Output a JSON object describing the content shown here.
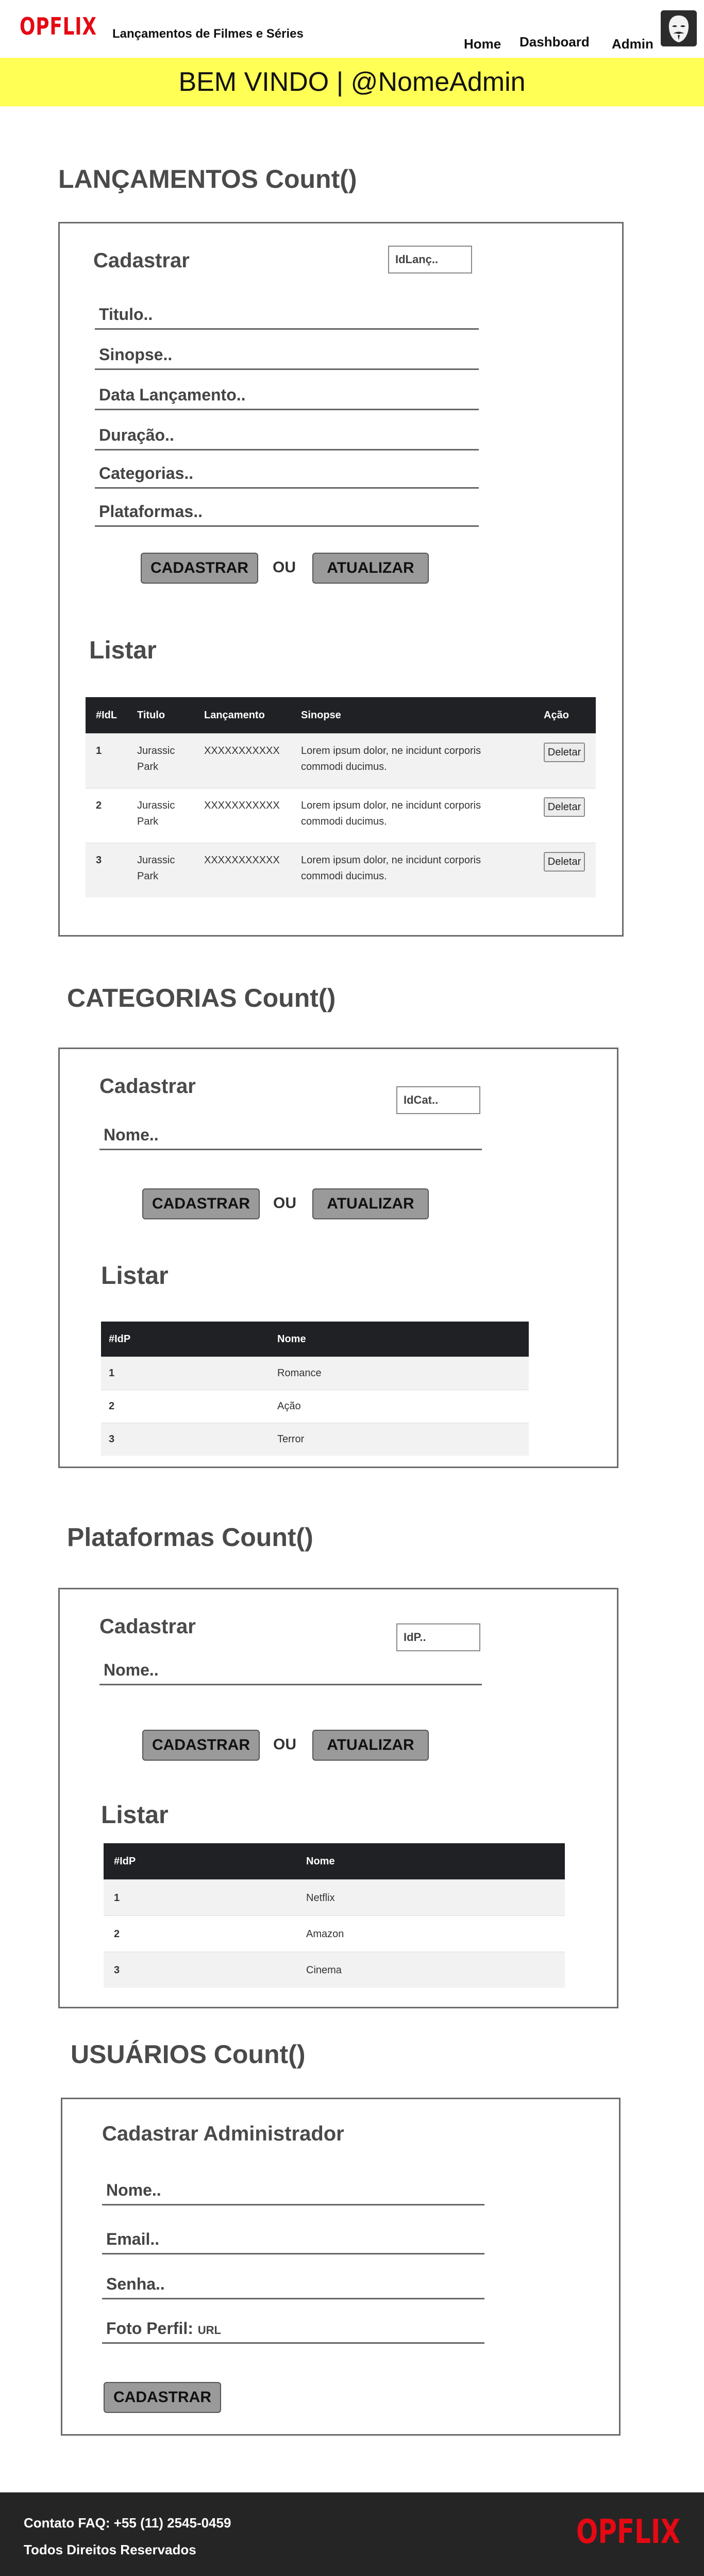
{
  "header": {
    "logo": "OPFLIX",
    "site_title": "Lançamentos de Filmes e Séries",
    "nav": {
      "home": "Home",
      "dashboard": "Dashboard",
      "admin": "Admin"
    }
  },
  "banner": {
    "text": "BEM VINDO | @NomeAdmin"
  },
  "lancamentos": {
    "title": "LANÇAMENTOS Count()",
    "form_title": "Cadastrar",
    "id_placeholder": "IdLanç..",
    "fields": [
      "Titulo..",
      "Sinopse..",
      "Data Lançamento..",
      "Duração..",
      "Categorias..",
      "Plataformas.."
    ],
    "btn_cadastrar": "CADASTRAR",
    "ou": "OU",
    "btn_atualizar": "ATUALIZAR",
    "list_title": "Listar",
    "columns": [
      "#IdL",
      "Titulo",
      "Lançamento",
      "Sinopse",
      "Ação"
    ],
    "rows": [
      {
        "id": "1",
        "titulo_1": "Jurassic",
        "titulo_2": "Park",
        "lancamento": "XXXXXXXXXXX",
        "sinopse_1": "Lorem ipsum dolor, ne incidunt corporis",
        "sinopse_2": "commodi ducimus.",
        "acao": "Deletar"
      },
      {
        "id": "2",
        "titulo_1": "Jurassic",
        "titulo_2": "Park",
        "lancamento": "XXXXXXXXXXX",
        "sinopse_1": "Lorem ipsum dolor, ne incidunt corporis",
        "sinopse_2": "commodi ducimus.",
        "acao": "Deletar"
      },
      {
        "id": "3",
        "titulo_1": "Jurassic",
        "titulo_2": "Park",
        "lancamento": "XXXXXXXXXXX",
        "sinopse_1": "Lorem ipsum dolor, ne incidunt corporis",
        "sinopse_2": "commodi ducimus.",
        "acao": "Deletar"
      }
    ]
  },
  "categorias": {
    "title": "CATEGORIAS Count()",
    "form_title": "Cadastrar",
    "id_placeholder": "IdCat..",
    "field_nome": "Nome..",
    "btn_cadastrar": "CADASTRAR",
    "ou": "OU",
    "btn_atualizar": "ATUALIZAR",
    "list_title": "Listar",
    "columns": [
      "#IdP",
      "Nome"
    ],
    "rows": [
      {
        "id": "1",
        "nome": "Romance"
      },
      {
        "id": "2",
        "nome": "Ação"
      },
      {
        "id": "3",
        "nome": "Terror"
      }
    ]
  },
  "plataformas": {
    "title": "Plataformas Count()",
    "form_title": "Cadastrar",
    "id_placeholder": "IdP..",
    "field_nome": "Nome..",
    "btn_cadastrar": "CADASTRAR",
    "ou": "OU",
    "btn_atualizar": "ATUALIZAR",
    "list_title": "Listar",
    "columns": [
      "#IdP",
      "Nome"
    ],
    "rows": [
      {
        "id": "1",
        "nome": "Netflix"
      },
      {
        "id": "2",
        "nome": "Amazon"
      },
      {
        "id": "3",
        "nome": "Cinema"
      }
    ]
  },
  "usuarios": {
    "title": "USUÁRIOS Count()",
    "form_title": "Cadastrar Administrador",
    "fields": [
      "Nome..",
      "Email..",
      "Senha.."
    ],
    "foto_label": "Foto Perfil:",
    "foto_hint": "URL",
    "btn_cadastrar": "CADASTRAR"
  },
  "footer": {
    "contato": "Contato FAQ: +55 (11) 2545-0459",
    "direitos": "Todos Direitos Reservados",
    "logo": "OPFLIX"
  },
  "colors": {
    "brand_red": "#e50914",
    "banner_yellow": "#ffff55",
    "table_head": "#1f2124",
    "footer_bg": "#252525"
  },
  "icons": {
    "avatar": "anonymous-mask-avatar-icon"
  }
}
